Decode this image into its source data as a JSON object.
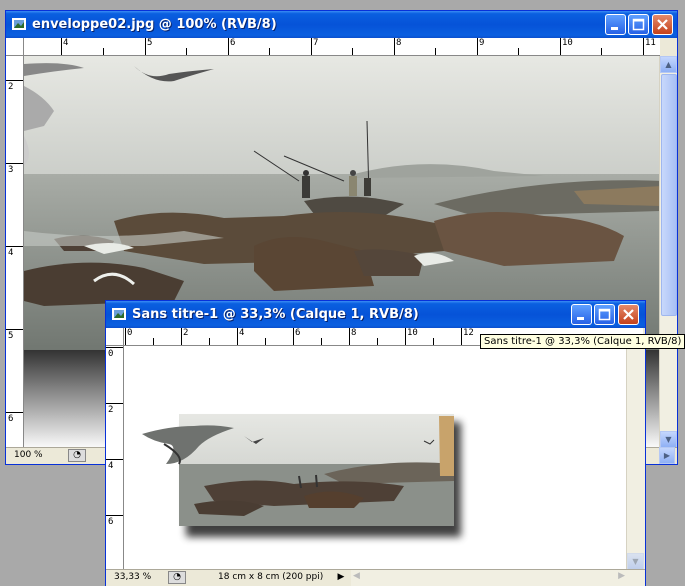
{
  "back_window": {
    "title": "enveloppe02.jpg @ 100% (RVB/8)",
    "ruler_h": [
      "4",
      "5",
      "6",
      "7",
      "8",
      "9",
      "10",
      "11"
    ],
    "ruler_v": [
      "2",
      "3",
      "4",
      "5",
      "6"
    ],
    "zoom": "100 %"
  },
  "front_window": {
    "title": "Sans titre-1 @ 33,3% (Calque 1, RVB/8)",
    "ruler_h": [
      "0",
      "2",
      "4",
      "6",
      "8",
      "10",
      "12"
    ],
    "ruler_v": [
      "0",
      "2",
      "4",
      "6"
    ],
    "zoom": "33,33 %",
    "doc_info": "18 cm x 8 cm (200 ppi)"
  },
  "tooltip": "Sans titre-1 @ 33,3% (Calque 1, RVB/8)",
  "colors": {
    "title_blue": "#0653d8",
    "close_red": "#c4411c"
  },
  "icons": [
    "photoshop-doc-icon",
    "minimize-icon",
    "maximize-icon",
    "close-icon",
    "scroll-up-icon",
    "scroll-down-icon",
    "scroll-right-icon",
    "scroll-left-icon",
    "status-menu-icon",
    "play-arrow-icon"
  ]
}
